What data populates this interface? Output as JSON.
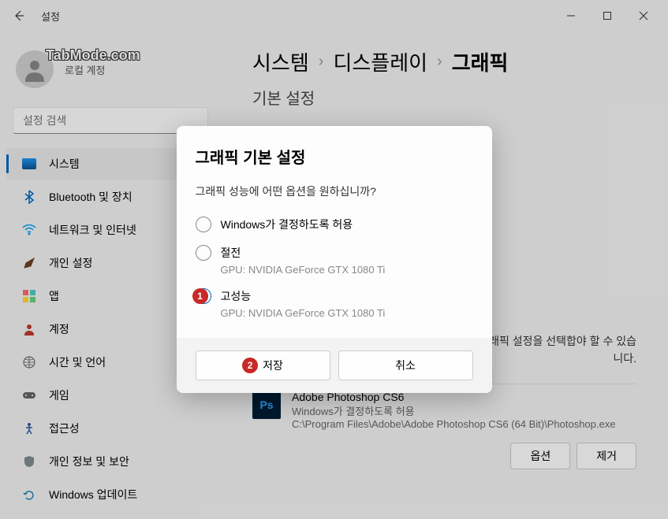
{
  "titlebar": {
    "title": "설정"
  },
  "watermark": "TabMode.com",
  "user": {
    "type": "로컬 계정"
  },
  "search": {
    "placeholder": "설정 검색"
  },
  "nav": {
    "items": [
      {
        "label": "시스템"
      },
      {
        "label": "Bluetooth 및 장치"
      },
      {
        "label": "네트워크 및 인터넷"
      },
      {
        "label": "개인 설정"
      },
      {
        "label": "앱"
      },
      {
        "label": "계정"
      },
      {
        "label": "시간 및 언어"
      },
      {
        "label": "게임"
      },
      {
        "label": "접근성"
      },
      {
        "label": "개인 정보 및 보안"
      },
      {
        "label": "Windows 업데이트"
      }
    ]
  },
  "breadcrumb": {
    "p1": "시스템",
    "p2": "디스플레이",
    "p3": "그래픽"
  },
  "subTitle": "기본 설정",
  "descText": "그래픽 설정을 선택합야 할 수 있습니다.",
  "app": {
    "iconText": "Ps",
    "name": "Adobe Photoshop CS6",
    "sub": "Windows가 결정하도록 허용",
    "path": "C:\\Program Files\\Adobe\\Adobe Photoshop CS6 (64 Bit)\\Photoshop.exe",
    "btnOption": "옵션",
    "btnRemove": "제거"
  },
  "modal": {
    "title": "그래픽 기본 설정",
    "question": "그래픽 성능에 어떤 옵션을 원하십니까?",
    "opts": [
      {
        "label": "Windows가 결정하도록 허용",
        "sub": ""
      },
      {
        "label": "절전",
        "sub": "GPU: NVIDIA GeForce GTX 1080 Ti"
      },
      {
        "label": "고성능",
        "sub": "GPU: NVIDIA GeForce GTX 1080 Ti"
      }
    ],
    "btnSave": "저장",
    "btnCancel": "취소",
    "anno1": "1",
    "anno2": "2"
  }
}
